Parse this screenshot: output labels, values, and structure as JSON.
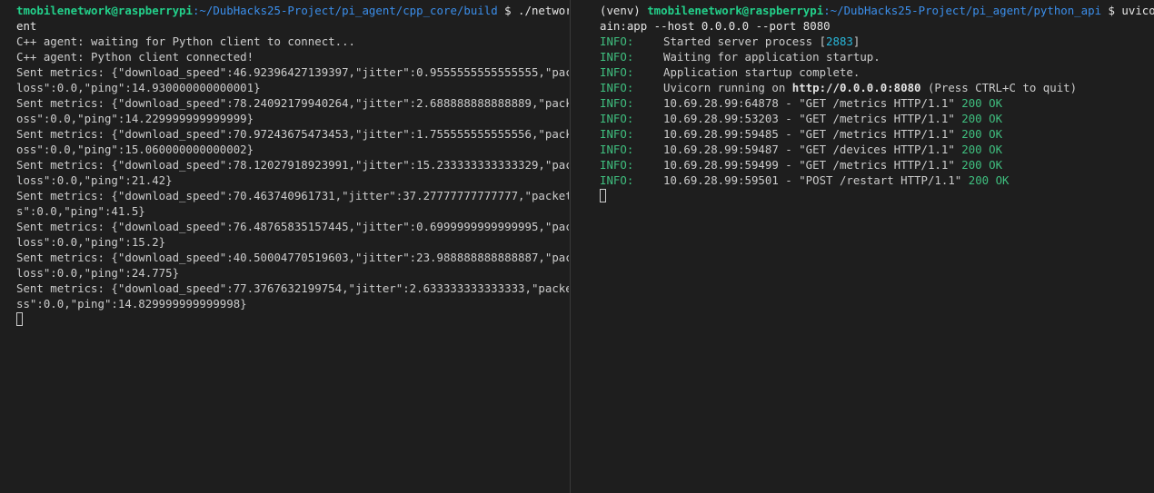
{
  "left_pane": {
    "prompt": {
      "user_host": "tmobilenetwork@raspberrypi",
      "path": ":~/DubHacks25-Project/pi_agent/cpp_core/build",
      "symbol": " $",
      "command": " ./network_ag",
      "command_wrap": "ent"
    },
    "lines": [
      "C++ agent: waiting for Python client to connect...",
      "C++ agent: Python client connected!",
      "Sent metrics: {\"download_speed\":46.92396427139397,\"jitter\":0.9555555555555555,\"packet_",
      "loss\":0.0,\"ping\":14.930000000000001}",
      "Sent metrics: {\"download_speed\":78.24092179940264,\"jitter\":2.688888888888889,\"packet_l",
      "oss\":0.0,\"ping\":14.229999999999999}",
      "Sent metrics: {\"download_speed\":70.97243675473453,\"jitter\":1.755555555555556,\"packet_l",
      "oss\":0.0,\"ping\":15.060000000000002}",
      "Sent metrics: {\"download_speed\":78.12027918923991,\"jitter\":15.233333333333329,\"packet_",
      "loss\":0.0,\"ping\":21.42}",
      "Sent metrics: {\"download_speed\":70.463740961731,\"jitter\":37.27777777777777,\"packet_los",
      "s\":0.0,\"ping\":41.5}",
      "Sent metrics: {\"download_speed\":76.48765835157445,\"jitter\":0.6999999999999995,\"packet_",
      "loss\":0.0,\"ping\":15.2}",
      "Sent metrics: {\"download_speed\":40.50004770519603,\"jitter\":23.988888888888887,\"packet_",
      "loss\":0.0,\"ping\":24.775}",
      "Sent metrics: {\"download_speed\":77.3767632199754,\"jitter\":2.633333333333333,\"packet_lo",
      "ss\":0.0,\"ping\":14.829999999999998}"
    ]
  },
  "right_pane": {
    "prompt": {
      "venv": "(venv) ",
      "user_host": "tmobilenetwork@raspberrypi",
      "path": ":~/DubHacks25-Project/pi_agent/python_api",
      "symbol": " $",
      "command": " uvicorn m",
      "command_wrap": "ain:app --host 0.0.0.0 --port 8080"
    },
    "log_level": "INFO:",
    "startup": {
      "started_prefix": "Started server process [",
      "pid": "2883",
      "started_suffix": "]",
      "waiting": "Waiting for application startup.",
      "complete": "Application startup complete.",
      "running_prefix": "Uvicorn running on ",
      "url": "http://0.0.0.0:8080",
      "running_suffix": " (Press CTRL+C to quit)"
    },
    "requests": [
      {
        "client": "10.69.28.99:64878",
        "request": "\"GET /metrics HTTP/1.1\"",
        "status": "200 OK"
      },
      {
        "client": "10.69.28.99:53203",
        "request": "\"GET /metrics HTTP/1.1\"",
        "status": "200 OK"
      },
      {
        "client": "10.69.28.99:59485",
        "request": "\"GET /metrics HTTP/1.1\"",
        "status": "200 OK"
      },
      {
        "client": "10.69.28.99:59487",
        "request": "\"GET /devices HTTP/1.1\"",
        "status": "200 OK"
      },
      {
        "client": "10.69.28.99:59499",
        "request": "\"GET /metrics HTTP/1.1\"",
        "status": "200 OK"
      },
      {
        "client": "10.69.28.99:59501",
        "request": "\"POST /restart HTTP/1.1\"",
        "status": "200 OK"
      }
    ],
    "separator": " - "
  },
  "colors": {
    "background": "#1e1e1e",
    "prompt_user": "#23d18b",
    "prompt_path": "#3b8eea",
    "info": "#23d18b",
    "pid": "#29b8db",
    "text": "#cccccc"
  }
}
